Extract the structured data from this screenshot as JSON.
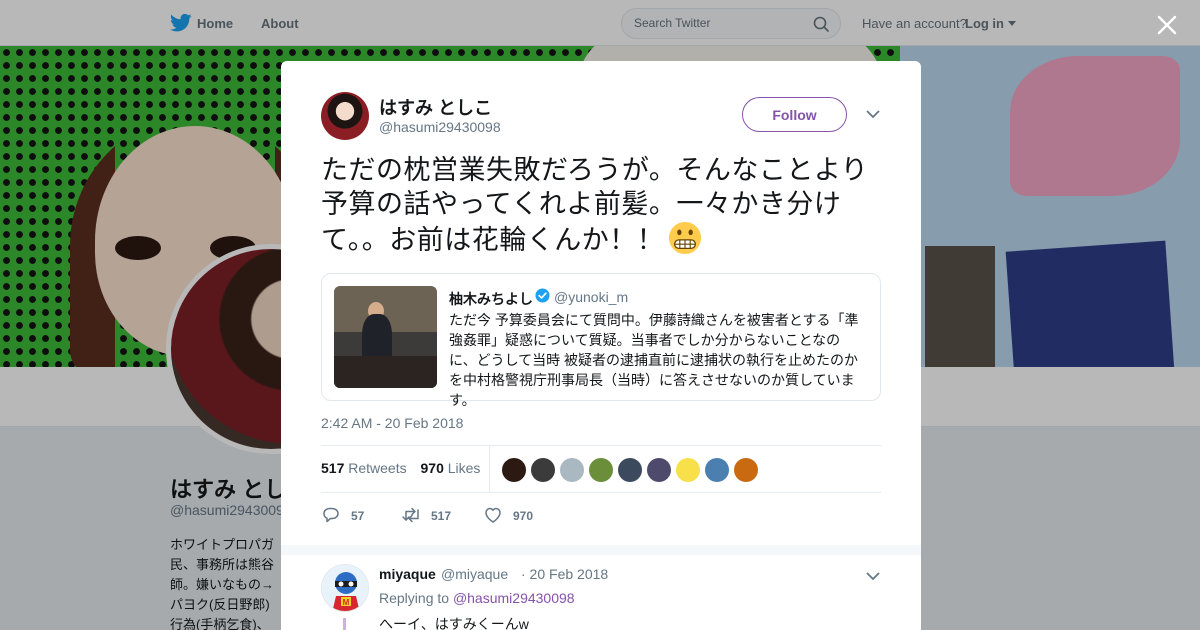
{
  "topbar": {
    "home_label": "Home",
    "about_label": "About",
    "search_placeholder": "Search Twitter",
    "have_account": "Have an account?",
    "login_label": "Log in",
    "brand_color": "#1da1f2"
  },
  "background_profile": {
    "name": "はすみ とし",
    "handle": "@hasumi2943009",
    "bio_lines": [
      "ホワイトプロパガ",
      "民、事務所は熊谷",
      "師。嫌いなもの→",
      "パヨク(反日野郎)",
      "行為(手柄乞食)、"
    ]
  },
  "tweet": {
    "author_name": "はすみ としこ",
    "author_handle": "@hasumi29430098",
    "follow_label": "Follow",
    "text": "ただの枕営業失敗だろうが。そんなことより予算の話やってくれよ前髪。一々かき分けて。。お前は花輪くんか！！",
    "emoji": "grimacing-face",
    "timestamp": "2:42 AM - 20 Feb 2018",
    "retweets_count": "517",
    "retweets_label": "Retweets",
    "likes_count": "970",
    "likes_label": "Likes",
    "accent_color": "#8553a9",
    "quoted": {
      "name": "柚木みちよし",
      "handle": "@yunoki_m",
      "verified": true,
      "text": "ただ今 予算委員会にて質問中。伊藤詩織さんを被害者とする「準強姦罪」疑惑について質疑。当事者でしか分からないことなのに、どうして当時 被疑者の逮捕直前に逮捕状の執行を止めたのかを中村格警視庁刑事局長（当時）に答えさせないのか質しています。"
    },
    "likers": [
      {
        "color": "#2c1a12"
      },
      {
        "color": "#3b3b3b"
      },
      {
        "color": "#aab8c2"
      },
      {
        "color": "#6a8e3a"
      },
      {
        "color": "#3c4a5e"
      },
      {
        "color": "#4e4a6b"
      },
      {
        "color": "#f7e04a"
      },
      {
        "color": "#4b7fb0"
      },
      {
        "color": "#c96a10"
      }
    ],
    "actions": {
      "reply_count": "57",
      "retweet_count": "517",
      "like_count": "970"
    }
  },
  "reply": {
    "name": "miyaque",
    "handle": "@miyaque",
    "date": "· 20 Feb 2018",
    "replying_to_label": "Replying to",
    "replying_to_handle": "@hasumi29430098",
    "text": "へーイ、はすみくーんw"
  }
}
